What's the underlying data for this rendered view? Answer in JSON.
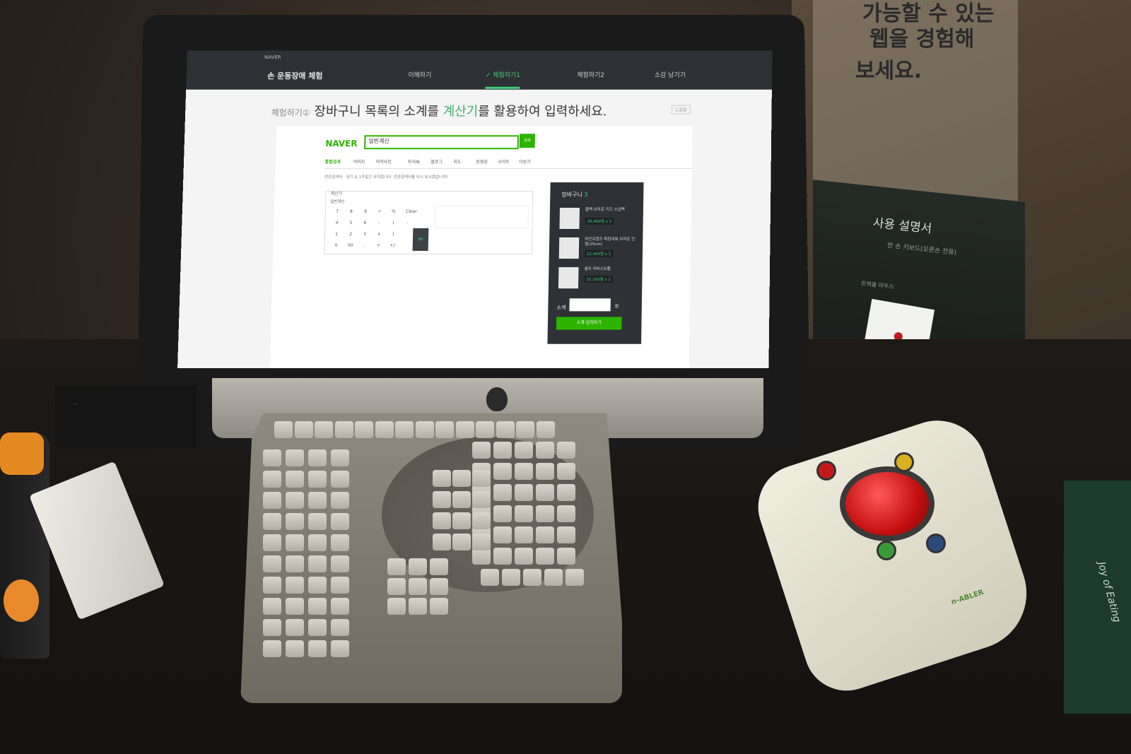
{
  "wall_sign": {
    "line1": "가능할 수 있는",
    "line2": "웹을 경험해",
    "line3": "보세요."
  },
  "site": {
    "brand": "NAVER",
    "title": "손 운동장애 체험",
    "tabs": [
      {
        "label": "이해하기",
        "active": false
      },
      {
        "label": "✓ 체험하기1",
        "active": true
      },
      {
        "label": "체험하기2",
        "active": false
      },
      {
        "label": "소감 남기기",
        "active": false
      }
    ],
    "accent_color": "#3fd17a"
  },
  "task": {
    "step": "체험하기①",
    "text_pre": "장바구니 목록의 소계를 ",
    "text_highlight": "계산기",
    "text_post": "를 활용하여 입력하세요.",
    "help_button": "도움말"
  },
  "naver": {
    "logo": "NAVER",
    "query": "일반계산",
    "search_button": "검색",
    "subtabs": [
      "통합검색",
      "이미지",
      "어학사전",
      "지식iN",
      "블로그",
      "지도",
      "동영상",
      "사이트",
      "더보기"
    ],
    "related": "연관검색어",
    "related_text": "당기 & 1주일간 유지됩니다. 연관검색어를 다시 보시겠습니까?",
    "brand_color": "#2db400"
  },
  "calculator": {
    "label": "계산기",
    "mode": "일반계산",
    "keys": [
      "7",
      "8",
      "9",
      "÷",
      "%",
      "Clear",
      "4",
      "5",
      "6",
      "-",
      "(",
      "-",
      "1",
      "2",
      "3",
      "x",
      ")",
      "0",
      "00",
      ".",
      "+",
      "+/-"
    ],
    "equals": "="
  },
  "cart": {
    "title": "장바구니",
    "count": "3",
    "items": [
      {
        "name": "블랙 브라운 키즈 스냅백",
        "price": "26,400원 x 1"
      },
      {
        "name": "라인프렌즈 파란내복 브라운 인형(25cm)",
        "price": "22,400원 x 1"
      },
      {
        "name": "샐리 리버스보틀",
        "price": "15,200원 x 1"
      }
    ],
    "subtotal_label": "소계",
    "subtotal_unit": "원",
    "submit": "소계 입력하기"
  },
  "manual": {
    "title": "사용 설명서",
    "subtitle": "한 손 키보드(오른손 전용)",
    "device": "트랙볼 마우스"
  },
  "mouse_brand": "n-ABLER",
  "box_text": "Joy of Eating"
}
